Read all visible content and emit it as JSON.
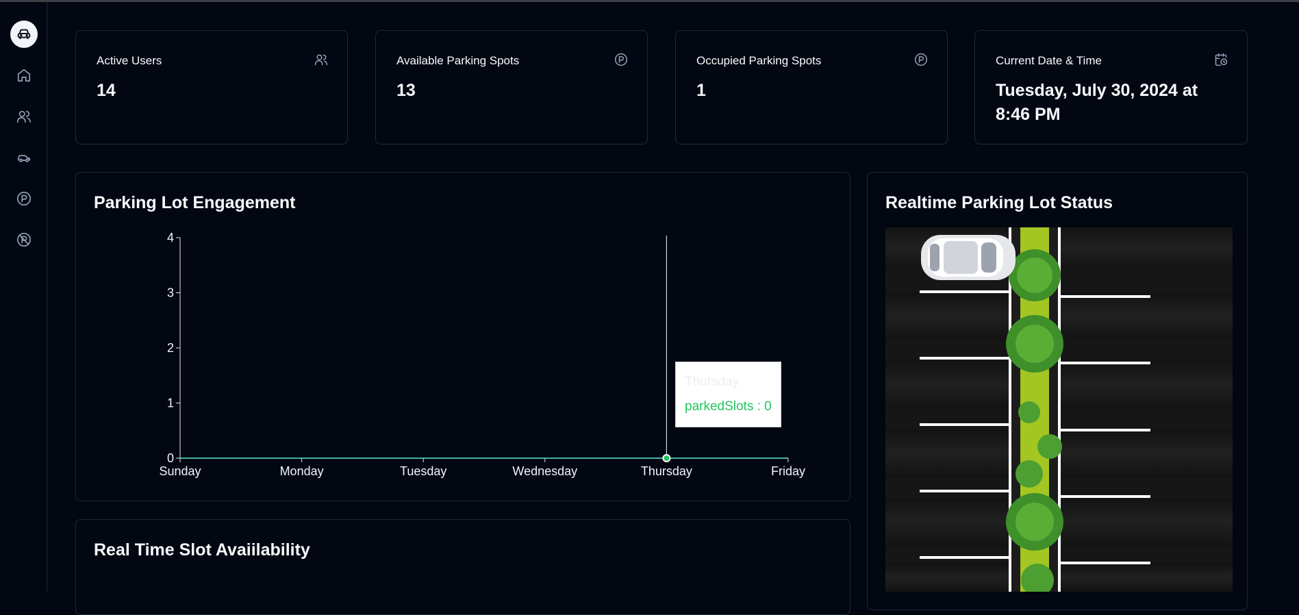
{
  "stats": [
    {
      "title": "Active Users",
      "value": "14",
      "icon": "users-icon"
    },
    {
      "title": "Available Parking Spots",
      "value": "13",
      "icon": "parking-icon"
    },
    {
      "title": "Occupied Parking Spots",
      "value": "1",
      "icon": "parking-icon"
    },
    {
      "title": "Current Date & Time",
      "value": "Tuesday, July 30, 2024 at 8:46 PM",
      "icon": "calendar-clock-icon"
    }
  ],
  "engagement": {
    "title": "Parking Lot Engagement"
  },
  "lot_status": {
    "title": "Realtime Parking Lot Status"
  },
  "slot_availability": {
    "title": "Real Time Slot Avaiilability"
  },
  "sidebar": [
    "car-logo-icon",
    "home-icon",
    "users-icon",
    "car-icon",
    "parking-icon",
    "no-parking-icon"
  ],
  "chart_data": {
    "type": "line",
    "categories": [
      "Sunday",
      "Monday",
      "Tuesday",
      "Wednesday",
      "Thursday",
      "Friday"
    ],
    "series": [
      {
        "name": "parkedSlots",
        "values": [
          0,
          0,
          0,
          0,
          0,
          null
        ]
      }
    ],
    "ylim": [
      0,
      4
    ],
    "yticks": [
      0,
      1,
      2,
      3,
      4
    ],
    "grid": false,
    "line_color": "#5eead4",
    "active_point": "Thursday",
    "tooltip": {
      "label": "Thursday",
      "value_text": "parkedSlots : 0"
    }
  },
  "colors": {
    "background": "#030712",
    "border": "#1e293b",
    "accent": "#22c55e"
  }
}
